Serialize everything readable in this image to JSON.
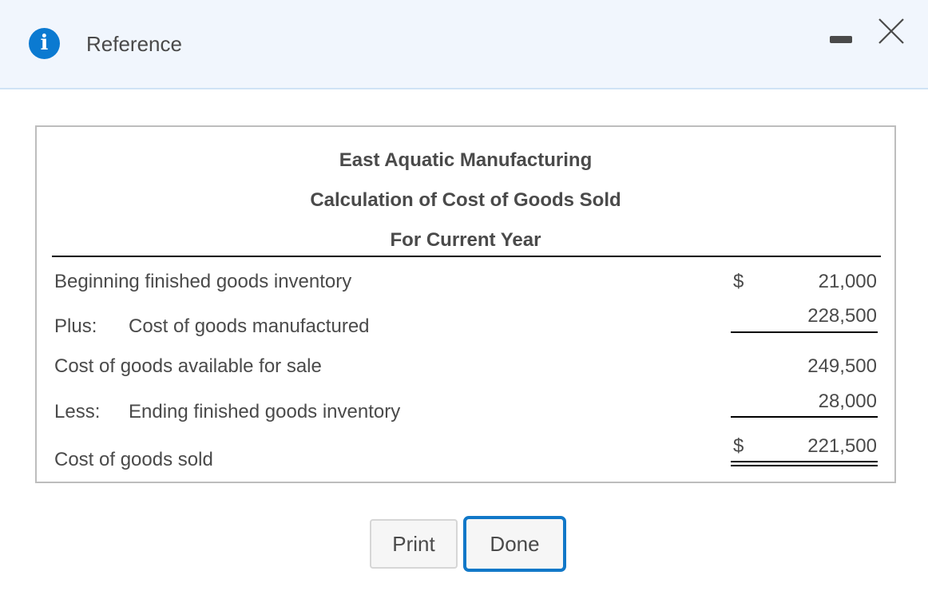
{
  "dialog": {
    "title": "Reference",
    "info_icon": "info-icon",
    "minimize_icon": "minimize-icon",
    "close_icon": "close-icon"
  },
  "report": {
    "company": "East Aquatic Manufacturing",
    "statement": "Calculation of Cost of Goods Sold",
    "period": "For Current Year",
    "rows": [
      {
        "prefix": "",
        "label": "Beginning finished goods inventory",
        "currency": "$",
        "amount": "21,000"
      },
      {
        "prefix": "Plus:",
        "label": "Cost of goods manufactured",
        "currency": "",
        "amount": "228,500"
      },
      {
        "prefix": "",
        "label": "Cost of goods available for sale",
        "currency": "",
        "amount": "249,500"
      },
      {
        "prefix": "Less:",
        "label": "Ending finished goods inventory",
        "currency": "",
        "amount": "28,000"
      },
      {
        "prefix": "",
        "label": "Cost of goods sold",
        "currency": "$",
        "amount": "221,500"
      }
    ]
  },
  "buttons": {
    "print": "Print",
    "done": "Done"
  },
  "colors": {
    "accent": "#0b7ad1",
    "header_bg": "#f1f6fd",
    "text": "#4a4a4a"
  }
}
